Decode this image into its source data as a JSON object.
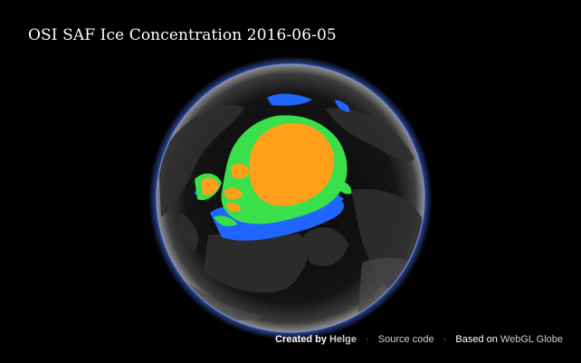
{
  "title": "OSI SAF Ice Concentration 2016-06-05",
  "footer": {
    "created_by": "Created by",
    "author": "Helge",
    "separator": "·",
    "source_code": "Source code",
    "based_on": "Based on",
    "engine": "WebGL Globe"
  },
  "colors": {
    "background": "#000000",
    "globe_rim": "#4a6fd8",
    "ice_high": "#ff9f1a",
    "ice_mid": "#39e04a",
    "ice_low": "#1f66ff",
    "land": "#3a3a3a",
    "ocean": "#0a0a0a"
  }
}
